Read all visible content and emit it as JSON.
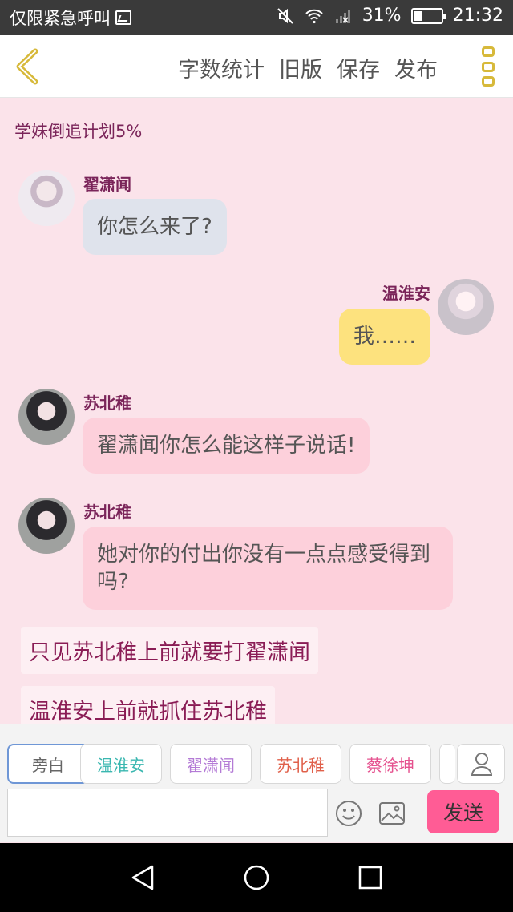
{
  "status": {
    "carrier": "仅限紧急呼叫",
    "battery": "31%",
    "time": "21:32"
  },
  "header": {
    "actions": [
      "字数统计",
      "旧版",
      "保存",
      "发布"
    ]
  },
  "story": {
    "title": "学妹倒追计划5%"
  },
  "messages": [
    {
      "speaker": "翟潇闻",
      "text": "你怎么来了?"
    },
    {
      "speaker": "温淮安",
      "text": "我……"
    },
    {
      "speaker": "苏北稚",
      "text": "翟潇闻你怎么能这样子说话!"
    },
    {
      "speaker": "苏北稚",
      "text": "她对你的付出你没有一点点感受得到吗?"
    }
  ],
  "narration": [
    "只见苏北稚上前就要打翟潇闻",
    "温淮安上前就抓住苏北稚"
  ],
  "roles": [
    {
      "label": "旁白",
      "color": "#666666"
    },
    {
      "label": "温淮安",
      "color": "#3ab7b0"
    },
    {
      "label": "翟潇闻",
      "color": "#b47bd6"
    },
    {
      "label": "苏北稚",
      "color": "#e0604a"
    },
    {
      "label": "蔡徐坤",
      "color": "#e5528f"
    }
  ],
  "composer": {
    "input_value": "",
    "send_label": "发送"
  },
  "colors": {
    "accent": "#ff5c95",
    "background": "#fbe3ea",
    "icon_yellow": "#d7b93a"
  }
}
